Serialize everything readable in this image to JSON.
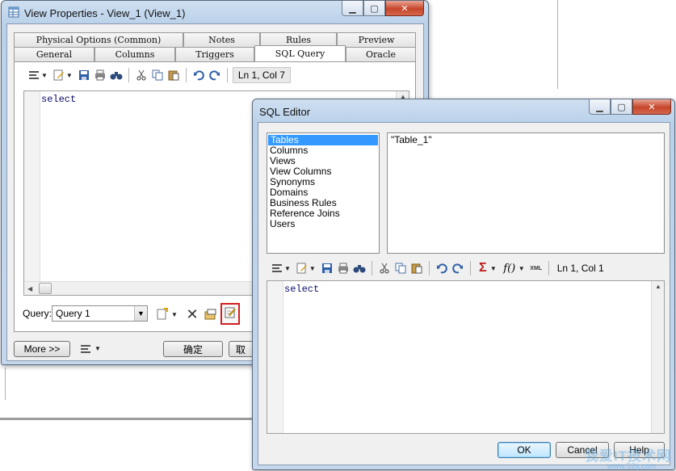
{
  "view_properties": {
    "title": "View Properties - View_1 (View_1)",
    "tabs_row1": [
      "Physical Options (Common)",
      "Notes",
      "Rules",
      "Preview"
    ],
    "tabs_row2": [
      "General",
      "Columns",
      "Triggers",
      "SQL Query",
      "Oracle"
    ],
    "active_tab": "SQL Query",
    "position": "Ln 1, Col 7",
    "sql_text": "select",
    "query_label": "Query:",
    "query_value": "Query 1",
    "more_button": "More >>",
    "ok_button": "确定",
    "cancel_partial": "取"
  },
  "sql_editor": {
    "title": "SQL Editor",
    "categories": [
      "Tables",
      "Columns",
      "Views",
      "View Columns",
      "Synonyms",
      "Domains",
      "Business Rules",
      "Reference Joins",
      "Users"
    ],
    "selected_category": "Tables",
    "items": [
      "\"Table_1\""
    ],
    "position": "Ln 1, Col 1",
    "sql_text": "select",
    "ok_button": "OK",
    "cancel_button": "Cancel",
    "help_button": "Help"
  },
  "watermark": {
    "text": "我爱IT技术网",
    "url": "www.52ij.com"
  },
  "colors": {
    "highlight": "#3399ff",
    "focus_box": "#d42020"
  }
}
